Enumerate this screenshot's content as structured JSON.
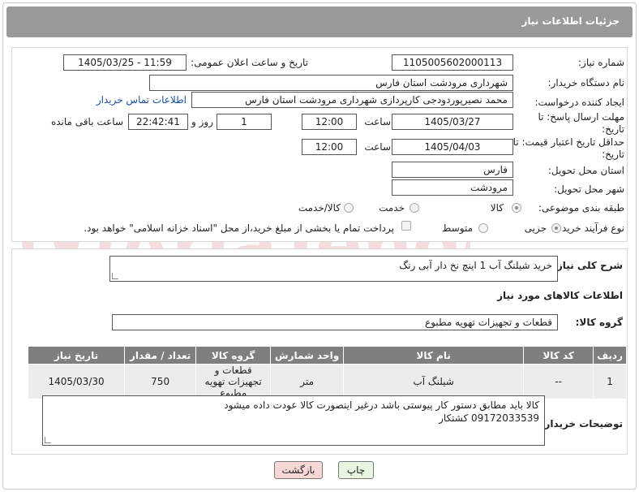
{
  "header": {
    "title": "جزئیات اطلاعات نیاز"
  },
  "fields": {
    "need_number_label": "شماره نیاز:",
    "need_number": "1105005602000113",
    "announce_label": "تاریخ و ساعت اعلان عمومی:",
    "announce_value": "1405/03/25 - 11:59",
    "buyer_org_label": "نام دستگاه خریدار:",
    "buyer_org": "شهرداری مرودشت استان فارس",
    "creator_label": "ایجاد کننده درخواست:",
    "creator": "محمد نصیرپوردودجی کارپردازی شهرداری مرودشت استان فارس",
    "buyer_contact_link": "اطلاعات تماس خریدار",
    "reply_deadline_label": "مهلت ارسال پاسخ: تا تاریخ:",
    "reply_date": "1405/03/27",
    "time_label": "ساعت",
    "reply_time": "12:00",
    "days_value": "1",
    "days_label": "روز و",
    "remaining_time": "22:42:41",
    "remaining_label": "ساعت باقی مانده",
    "price_validity_label": "حداقل تاریخ اعتبار قیمت: تا تاریخ:",
    "price_date": "1405/04/03",
    "price_time": "12:00",
    "province_label": "استان محل تحویل:",
    "province": "فارس",
    "city_label": "شهر محل تحویل:",
    "city": "مرودشت",
    "category_label": "طبقه بندی موضوعی:",
    "category_options": [
      "کالا",
      "خدمت",
      "کالا/خدمت"
    ],
    "process_label": "نوع فرآیند خرید :",
    "process_options": [
      "جزیی",
      "متوسط"
    ],
    "payment_note": "پرداخت تمام یا بخشی از مبلغ خرید،از محل \"اسناد خزانه اسلامی\" خواهد بود."
  },
  "summary": {
    "label": "شرح کلی نیاز:",
    "text": "خرید شیلنگ آب 1 اینچ نخ دار آبی رنگ"
  },
  "goods": {
    "section_title": "اطلاعات کالاهای مورد نیاز",
    "group_label": "گروه کالا:",
    "group_value": "قطعات و تجهیزات تهویه مطبوع",
    "columns": [
      "ردیف",
      "کد کالا",
      "نام کالا",
      "واحد شمارش",
      "گروه کالا",
      "تعداد / مقدار",
      "تاریخ نیاز"
    ],
    "rows": [
      {
        "row": "1",
        "code": "--",
        "name": "شیلنگ آب",
        "unit": "متر",
        "group": "قطعات و تجهیزات تهویه مطبوع",
        "qty": "750",
        "date": "1405/03/30"
      }
    ]
  },
  "buyer_notes": {
    "label": "توضیحات خریدار:",
    "line1": "کالا باید مطابق دستور کار پیوستی باشد درغیر اینصورت کالا عودت داده میشود",
    "line2": "09172033539    کشتکار"
  },
  "buttons": {
    "print": "چاپ",
    "back": "بازگشت"
  },
  "watermark": {
    "text": "AriaTender.net"
  },
  "colors": {
    "header_bg": "#999999",
    "table_header": "#7f7f7f",
    "back_button": "#f8d7d7",
    "print_button": "#e8f5e0"
  }
}
